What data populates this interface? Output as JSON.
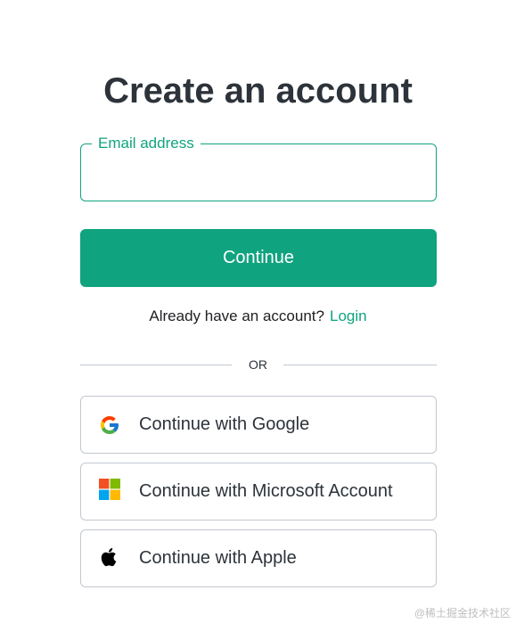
{
  "title": "Create an account",
  "email": {
    "label": "Email address",
    "value": "",
    "placeholder": ""
  },
  "continue_label": "Continue",
  "login_prompt": "Already have an account?",
  "login_link": "Login",
  "divider": "OR",
  "social": {
    "google": "Continue with Google",
    "microsoft": "Continue with Microsoft Account",
    "apple": "Continue with Apple"
  },
  "watermark": "@稀土掘金技术社区",
  "colors": {
    "accent": "#10a37f",
    "text": "#2d333a",
    "border": "#c2c8d0"
  },
  "icons": [
    "google-logo-icon",
    "microsoft-logo-icon",
    "apple-logo-icon"
  ]
}
